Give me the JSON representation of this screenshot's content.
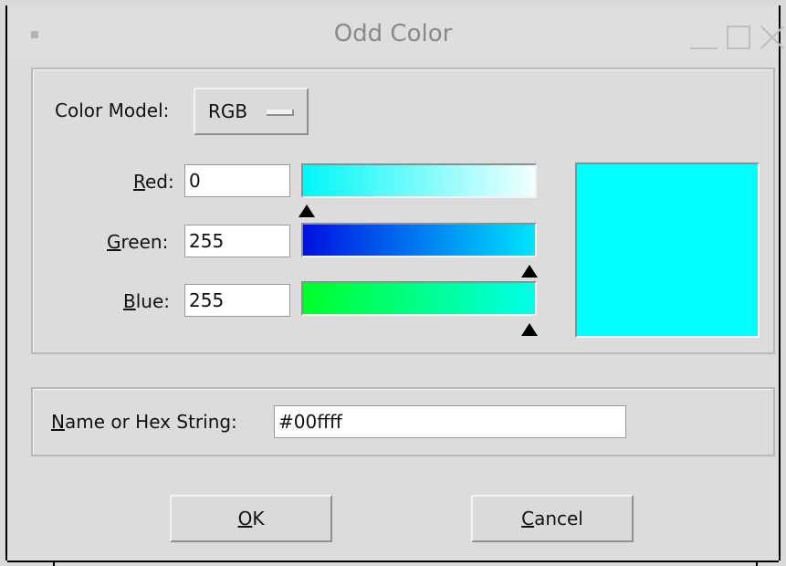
{
  "window": {
    "title": "Odd Color"
  },
  "color_model": {
    "label": "Color Model:",
    "selected": "RGB"
  },
  "channels": {
    "red": {
      "label_first": "R",
      "label_rest": "ed:",
      "value": "0",
      "slider_fraction": 0.0
    },
    "green": {
      "label_first": "G",
      "label_rest": "reen:",
      "value": "255",
      "slider_fraction": 1.0
    },
    "blue": {
      "label_first": "B",
      "label_rest": "lue:",
      "value": "255",
      "slider_fraction": 1.0
    }
  },
  "preview": {
    "color": "#00ffff"
  },
  "name_hex": {
    "label_first": "N",
    "label_rest": "ame or Hex String:",
    "value": "#00ffff"
  },
  "buttons": {
    "ok": {
      "first": "O",
      "rest": "K"
    },
    "cancel": {
      "first": "C",
      "rest": "ancel"
    }
  }
}
